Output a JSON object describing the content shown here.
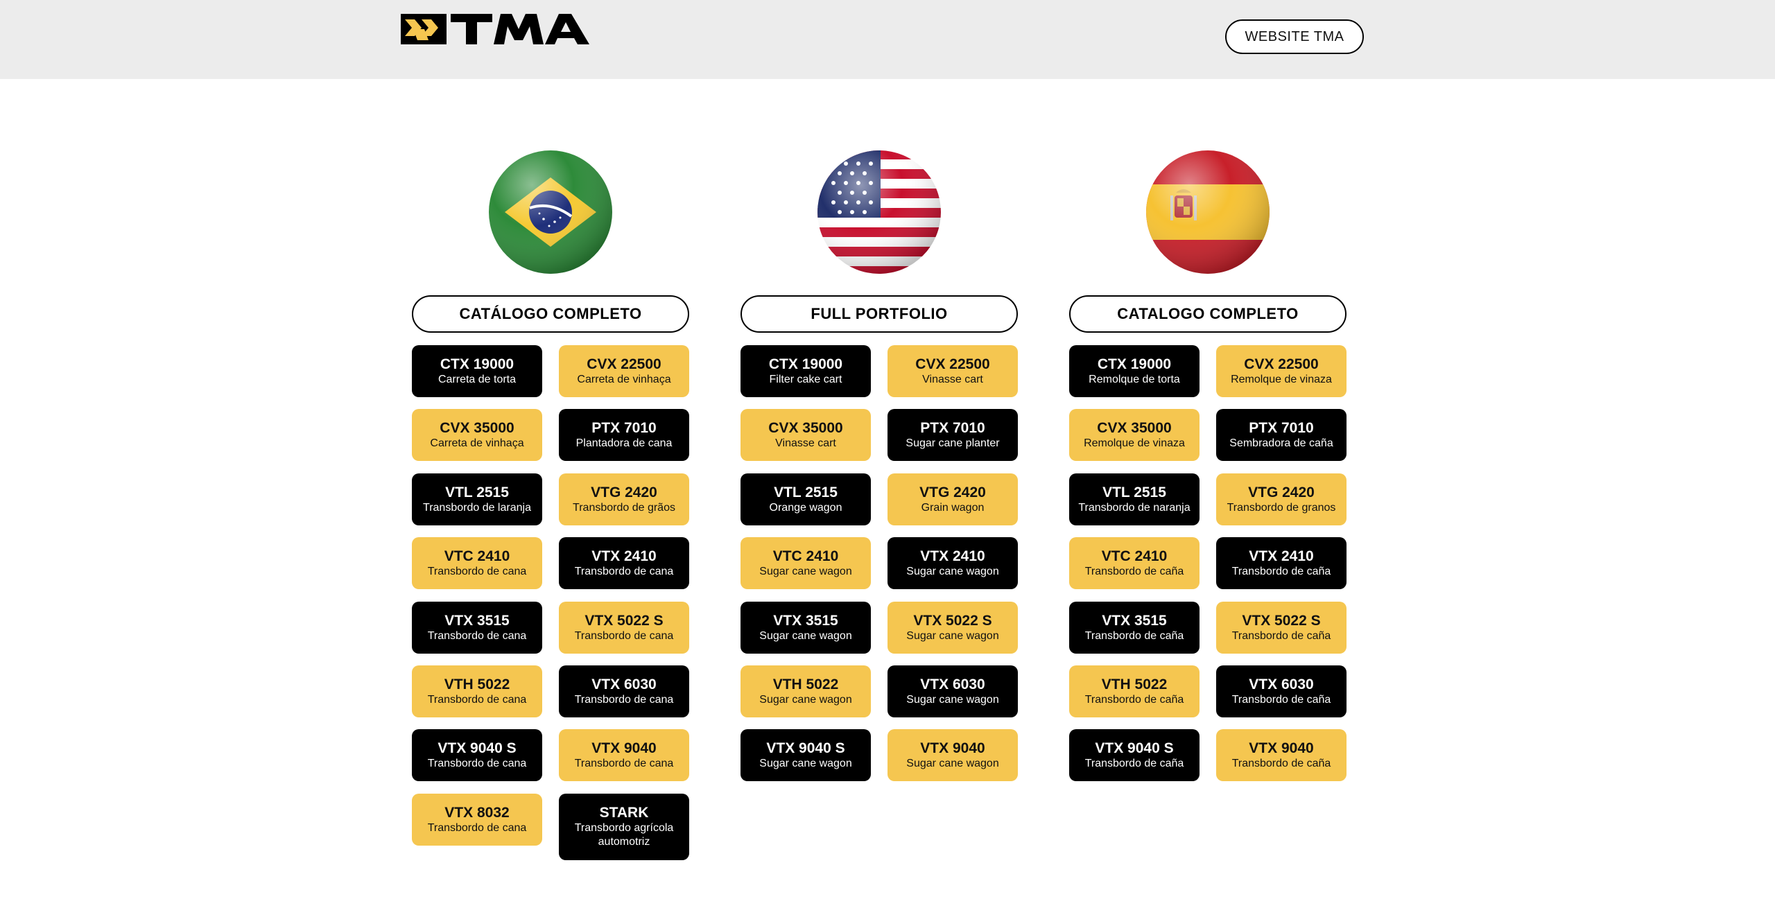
{
  "header": {
    "logo_text": "TMA",
    "website_button": "WEBSITE TMA"
  },
  "colors": {
    "accent": "#f5c650",
    "dark": "#000000",
    "header_bg": "#ececec"
  },
  "columns": [
    {
      "flag": "brazil-flag-icon",
      "catalog_button": "CATÁLOGO COMPLETO",
      "products": [
        {
          "name": "CTX 19000",
          "desc": "Carreta de torta"
        },
        {
          "name": "CVX 22500",
          "desc": "Carreta de vinhaça"
        },
        {
          "name": "CVX 35000",
          "desc": "Carreta de vinhaça"
        },
        {
          "name": "PTX 7010",
          "desc": "Plantadora de cana"
        },
        {
          "name": "VTL 2515",
          "desc": "Transbordo de laranja"
        },
        {
          "name": "VTG 2420",
          "desc": "Transbordo de grãos"
        },
        {
          "name": "VTC 2410",
          "desc": "Transbordo de cana"
        },
        {
          "name": "VTX 2410",
          "desc": "Transbordo de cana"
        },
        {
          "name": "VTX 3515",
          "desc": "Transbordo de cana"
        },
        {
          "name": "VTX 5022 S",
          "desc": "Transbordo de cana"
        },
        {
          "name": "VTH 5022",
          "desc": "Transbordo de cana"
        },
        {
          "name": "VTX 6030",
          "desc": "Transbordo de cana"
        },
        {
          "name": "VTX 9040 S",
          "desc": "Transbordo de cana"
        },
        {
          "name": "VTX 9040",
          "desc": "Transbordo de cana"
        },
        {
          "name": "VTX 8032",
          "desc": "Transbordo de cana"
        },
        {
          "name": "STARK",
          "desc": "Transbordo agrícola automotriz"
        }
      ]
    },
    {
      "flag": "usa-flag-icon",
      "catalog_button": "FULL PORTFOLIO",
      "products": [
        {
          "name": "CTX 19000",
          "desc": "Filter cake cart"
        },
        {
          "name": "CVX 22500",
          "desc": "Vinasse cart"
        },
        {
          "name": "CVX 35000",
          "desc": "Vinasse cart"
        },
        {
          "name": "PTX 7010",
          "desc": "Sugar cane planter"
        },
        {
          "name": "VTL 2515",
          "desc": "Orange wagon"
        },
        {
          "name": "VTG 2420",
          "desc": "Grain wagon"
        },
        {
          "name": "VTC 2410",
          "desc": "Sugar cane wagon"
        },
        {
          "name": "VTX 2410",
          "desc": "Sugar cane wagon"
        },
        {
          "name": "VTX 3515",
          "desc": "Sugar cane wagon"
        },
        {
          "name": "VTX 5022 S",
          "desc": "Sugar cane wagon"
        },
        {
          "name": "VTH 5022",
          "desc": "Sugar cane wagon"
        },
        {
          "name": "VTX 6030",
          "desc": "Sugar cane wagon"
        },
        {
          "name": "VTX 9040 S",
          "desc": "Sugar cane wagon"
        },
        {
          "name": "VTX 9040",
          "desc": "Sugar cane wagon"
        }
      ]
    },
    {
      "flag": "spain-flag-icon",
      "catalog_button": "CATALOGO COMPLETO",
      "products": [
        {
          "name": "CTX 19000",
          "desc": "Remolque de torta"
        },
        {
          "name": "CVX 22500",
          "desc": "Remolque de vinaza"
        },
        {
          "name": "CVX 35000",
          "desc": "Remolque de vinaza"
        },
        {
          "name": "PTX 7010",
          "desc": "Sembradora de caña"
        },
        {
          "name": "VTL 2515",
          "desc": "Transbordo de naranja"
        },
        {
          "name": "VTG 2420",
          "desc": "Transbordo de granos"
        },
        {
          "name": "VTC 2410",
          "desc": "Transbordo de caña"
        },
        {
          "name": "VTX 2410",
          "desc": "Transbordo de caña"
        },
        {
          "name": "VTX 3515",
          "desc": "Transbordo de caña"
        },
        {
          "name": "VTX 5022 S",
          "desc": "Transbordo de caña"
        },
        {
          "name": "VTH 5022",
          "desc": "Transbordo de caña"
        },
        {
          "name": "VTX 6030",
          "desc": "Transbordo de caña"
        },
        {
          "name": "VTX 9040 S",
          "desc": "Transbordo de caña"
        },
        {
          "name": "VTX 9040",
          "desc": "Transbordo de caña"
        }
      ]
    }
  ]
}
